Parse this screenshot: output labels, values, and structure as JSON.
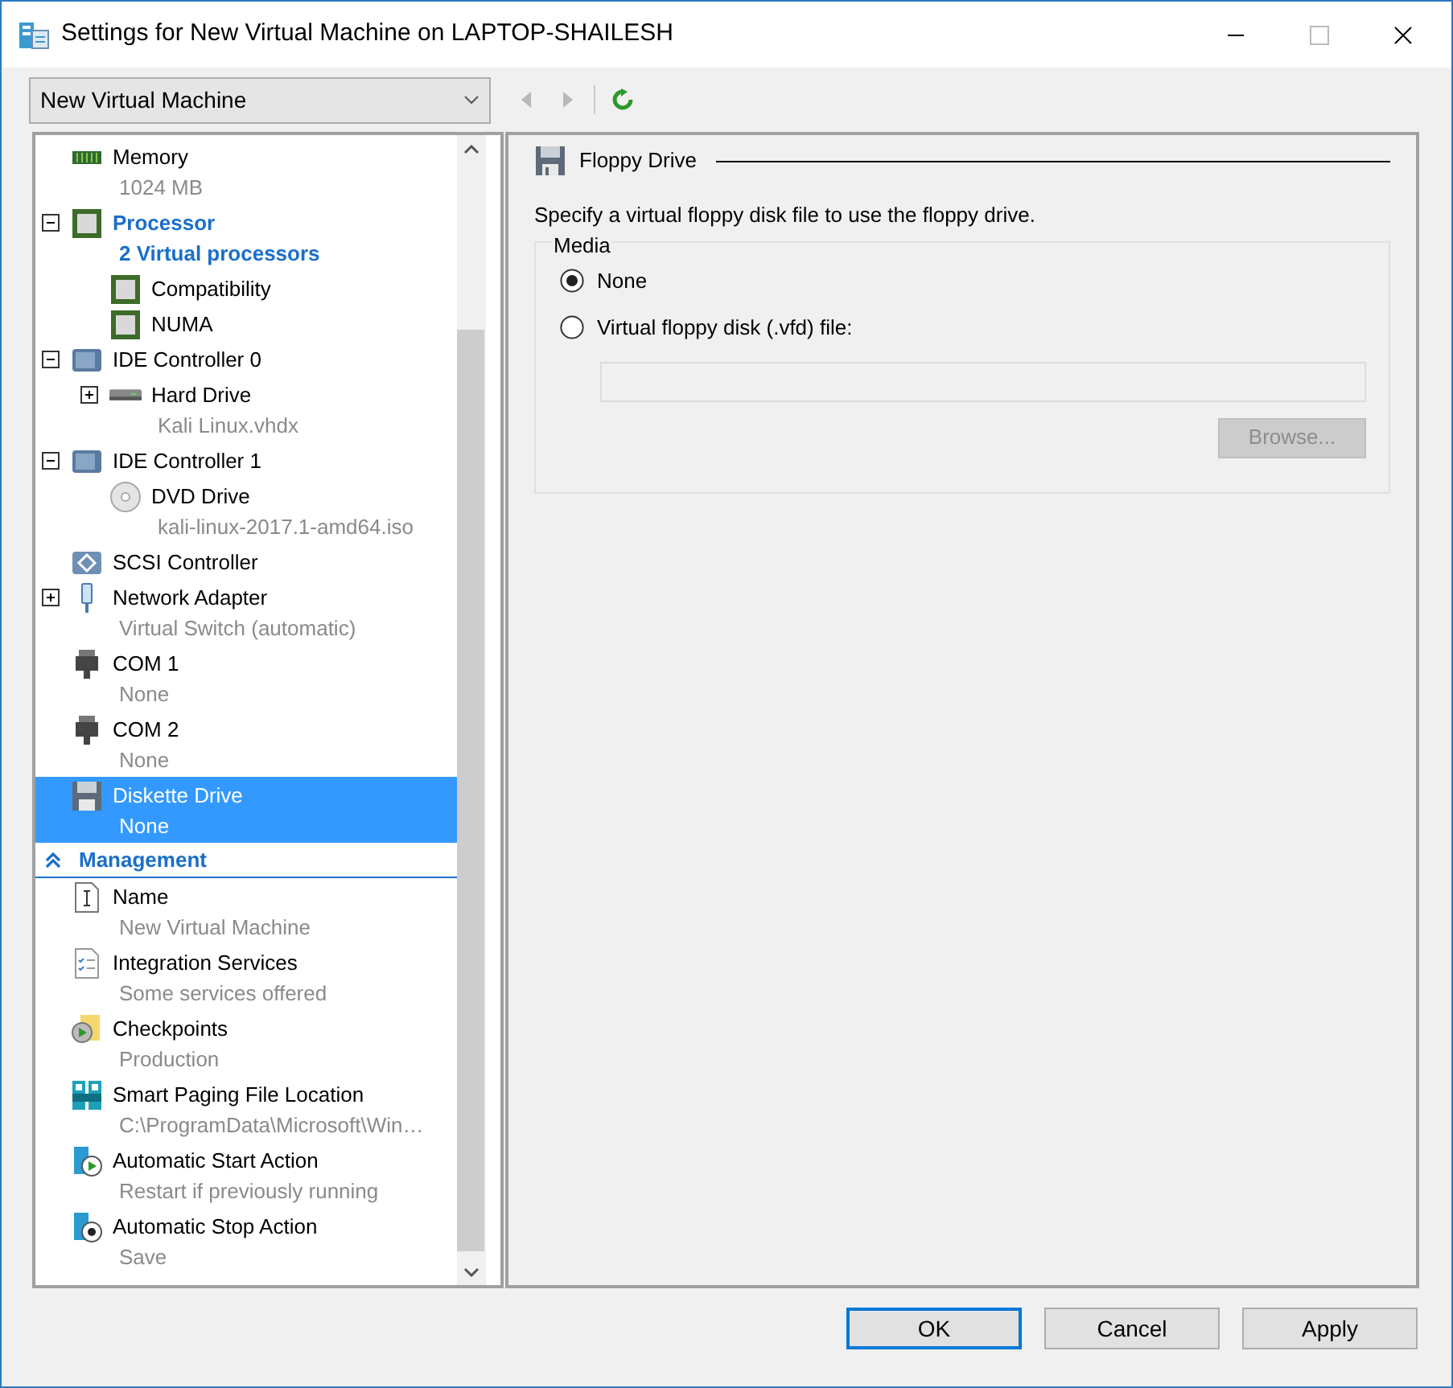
{
  "window": {
    "title": "Settings for New Virtual Machine on LAPTOP-SHAILESH"
  },
  "vm_select": {
    "value": "New Virtual Machine"
  },
  "nav_buttons": [
    {
      "kind": "back",
      "disabled": true
    },
    {
      "kind": "forward",
      "disabled": true
    },
    {
      "kind": "refresh"
    }
  ],
  "tree": {
    "sections": [
      {
        "items": [
          {
            "kind": "memory",
            "label": "Memory",
            "detail": "1024 MB",
            "selected": false,
            "emphasized": false
          },
          {
            "kind": "chip",
            "label": "Processor",
            "detail": "2 Virtual processors",
            "selected": false,
            "emphasized": true,
            "expanded": true,
            "children": [
              {
                "kind": "chip",
                "label": "Compatibility",
                "selected": false,
                "emphasized": false
              },
              {
                "kind": "chip",
                "label": "NUMA",
                "selected": false,
                "emphasized": false
              }
            ]
          },
          {
            "kind": "controller",
            "label": "IDE Controller 0",
            "selected": false,
            "emphasized": false,
            "expanded": true,
            "children": [
              {
                "kind": "disk",
                "label": "Hard Drive",
                "detail": "Kali Linux.vhdx",
                "selected": false,
                "emphasized": false,
                "expanded": false
              }
            ]
          },
          {
            "kind": "controller",
            "label": "IDE Controller 1",
            "selected": false,
            "emphasized": false,
            "expanded": true,
            "children": [
              {
                "kind": "dvd",
                "label": "DVD Drive",
                "detail": "kali-linux-2017.1-amd64.iso",
                "selected": false,
                "emphasized": false
              }
            ]
          },
          {
            "kind": "scsi",
            "label": "SCSI Controller",
            "selected": false,
            "emphasized": false
          },
          {
            "kind": "network",
            "label": "Network Adapter",
            "detail": "Virtual Switch (automatic)",
            "selected": false,
            "emphasized": false,
            "expanded": false
          },
          {
            "kind": "com",
            "label": "COM 1",
            "detail": "None",
            "selected": false,
            "emphasized": false
          },
          {
            "kind": "com",
            "label": "COM 2",
            "detail": "None",
            "selected": false,
            "emphasized": false
          },
          {
            "kind": "floppy",
            "label": "Diskette Drive",
            "detail": "None",
            "selected": true,
            "emphasized": false
          }
        ]
      },
      {
        "heading": "Management",
        "expanded": true,
        "items": [
          {
            "kind": "name",
            "label": "Name",
            "detail": "New Virtual Machine",
            "selected": false,
            "emphasized": false
          },
          {
            "kind": "integration",
            "label": "Integration Services",
            "detail": "Some services offered",
            "selected": false,
            "emphasized": false
          },
          {
            "kind": "checkpoint",
            "label": "Checkpoints",
            "detail": "Production",
            "selected": false,
            "emphasized": false
          },
          {
            "kind": "paging",
            "label": "Smart Paging File Location",
            "detail": "C:\\ProgramData\\Microsoft\\Win…",
            "selected": false,
            "emphasized": false
          },
          {
            "kind": "start",
            "label": "Automatic Start Action",
            "detail": "Restart if previously running",
            "selected": false,
            "emphasized": false
          },
          {
            "kind": "stop",
            "label": "Automatic Stop Action",
            "detail": "Save",
            "selected": false,
            "emphasized": false
          }
        ]
      }
    ]
  },
  "panel": {
    "title": "Floppy Drive",
    "description": "Specify a virtual floppy disk file to use the floppy drive.",
    "group": "Media",
    "options": [
      {
        "label": "None",
        "selected": true
      },
      {
        "label": "Virtual floppy disk (.vfd) file:",
        "selected": false
      }
    ],
    "path_field": {
      "disabled": true
    },
    "browse_button": {
      "label": "Browse...",
      "disabled": true
    }
  },
  "buttons": [
    {
      "label": "OK",
      "default": true
    },
    {
      "label": "Cancel",
      "default": false
    },
    {
      "label": "Apply",
      "default": false
    }
  ]
}
